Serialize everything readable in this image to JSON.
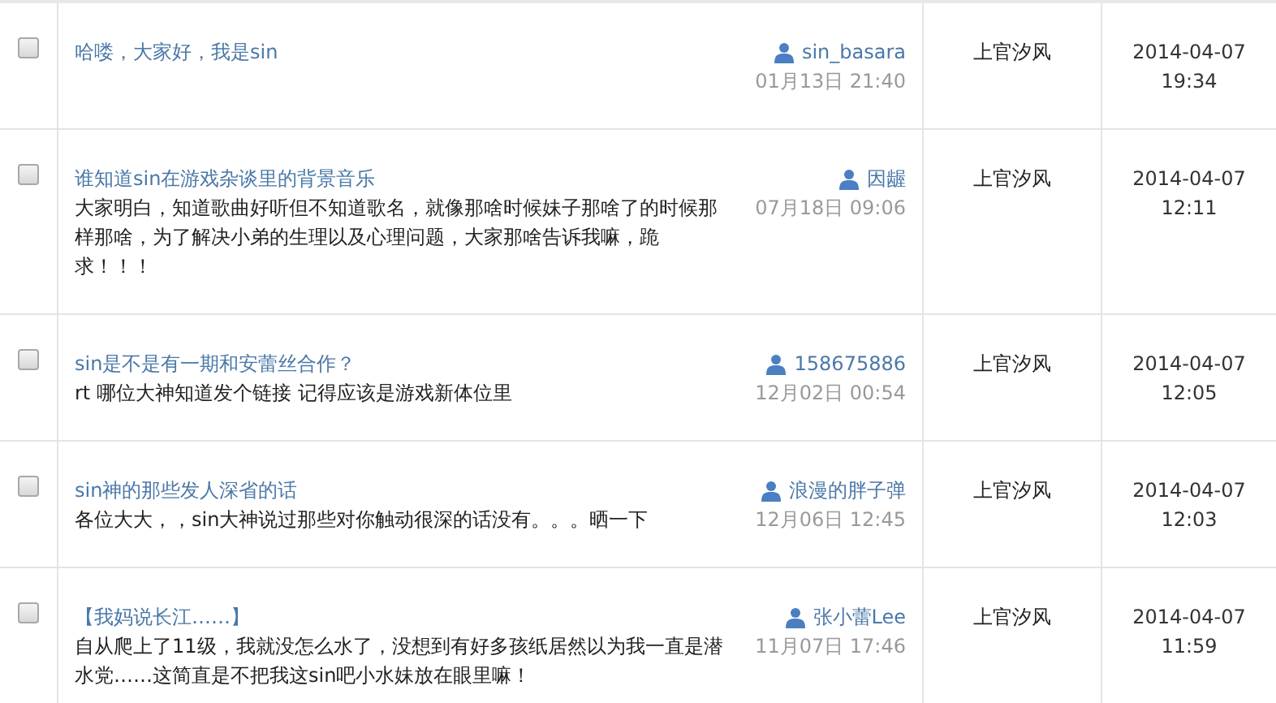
{
  "rows": [
    {
      "checked": false,
      "title": "哈喽，大家好，我是sin",
      "body": "",
      "author": "sin_basara",
      "posted": "01月13日 21:40",
      "assignee": "上官汐风",
      "date": "2014-04-07",
      "time": "19:34"
    },
    {
      "checked": false,
      "title": "谁知道sin在游戏杂谈里的背景音乐",
      "body": "大家明白，知道歌曲好听但不知道歌名，就像那啥时候妹子那啥了的时候那样那啥，为了解决小弟的生理以及心理问题，大家那啥告诉我嘛，跪求！！！",
      "author": "因龌",
      "posted": "07月18日 09:06",
      "assignee": "上官汐风",
      "date": "2014-04-07",
      "time": "12:11"
    },
    {
      "checked": false,
      "title": "sin是不是有一期和安蕾丝合作？",
      "body": "rt 哪位大神知道发个链接 记得应该是游戏新体位里",
      "author": "158675886",
      "posted": "12月02日 00:54",
      "assignee": "上官汐风",
      "date": "2014-04-07",
      "time": "12:05"
    },
    {
      "checked": false,
      "title": "sin神的那些发人深省的话",
      "body": "各位大大，，sin大神说过那些对你触动很深的话没有。。。晒一下",
      "author": "浪漫的胖子弹",
      "posted": "12月06日 12:45",
      "assignee": "上官汐风",
      "date": "2014-04-07",
      "time": "12:03"
    },
    {
      "checked": false,
      "title": "【我妈说长江……】",
      "body": "自从爬上了11级，我就没怎么水了，没想到有好多孩纸居然以为我一直是潜水党……这简直是不把我这sin吧小水妹放在眼里嘛！",
      "author": "张小蕾Lee",
      "posted": "11月07日 17:46",
      "assignee": "上官汐风",
      "date": "2014-04-07",
      "time": "11:59"
    }
  ]
}
